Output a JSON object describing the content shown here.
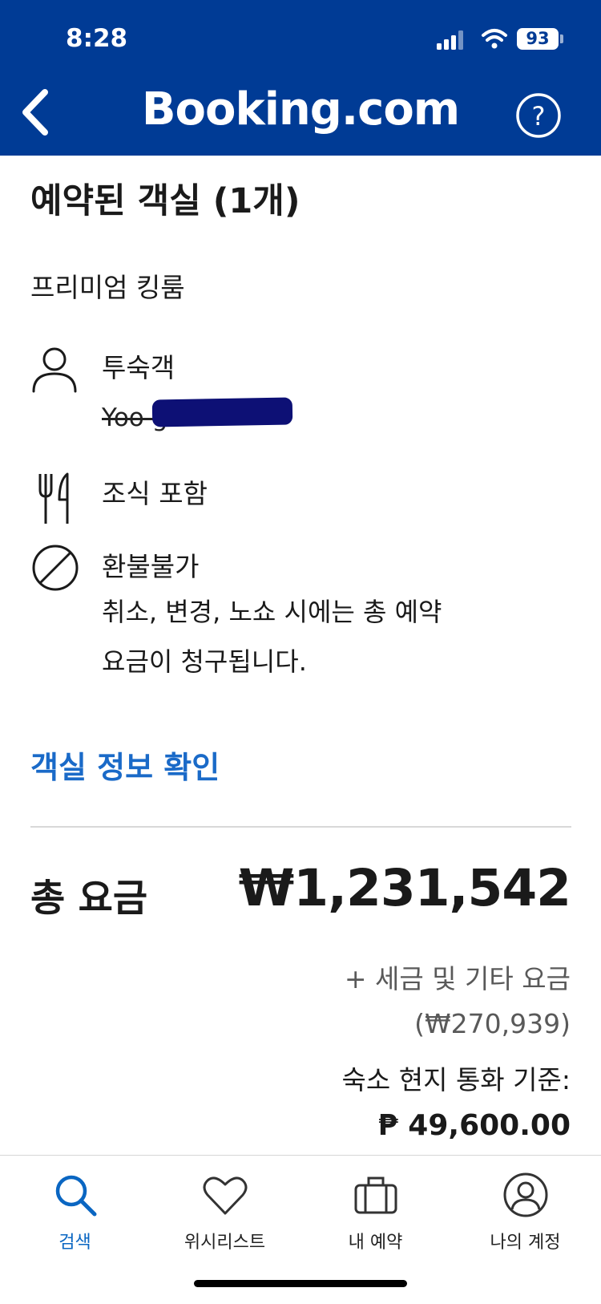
{
  "status_bar": {
    "time": "8:28",
    "battery": "93"
  },
  "header": {
    "brand": "Booking.com"
  },
  "room_section": {
    "title": "예약된 객실 (1개)",
    "room_name": "프리미엄 킹룸",
    "guest_label": "투숙객",
    "guest_name": "Yoo      g",
    "meal_label": "조식 포함",
    "refund_label": "환불불가",
    "refund_note_line1": "취소, 변경, 노쇼 시에는 총 예약",
    "refund_note_line2": "요금이 청구됩니다.",
    "room_info_link": "객실 정보 확인"
  },
  "price": {
    "total_label": "총 요금",
    "total_amount": "₩1,231,542",
    "taxes_label": "+ 세금 및 기타 요금",
    "taxes_amount": "(₩270,939)",
    "local_currency_label": "숙소 현지 통화 기준:",
    "local_amount": "₱ 49,600.00"
  },
  "tabbar": {
    "tabs": [
      {
        "label": "검색",
        "icon": "search-icon",
        "active": true
      },
      {
        "label": "위시리스트",
        "icon": "heart-icon",
        "active": false
      },
      {
        "label": "내 예약",
        "icon": "suitcase-icon",
        "active": false
      },
      {
        "label": "나의 계정",
        "icon": "account-icon",
        "active": false
      }
    ]
  },
  "colors": {
    "brand_blue": "#003b95",
    "link_blue": "#1a6ac8",
    "active_tab": "#0a66c2"
  }
}
